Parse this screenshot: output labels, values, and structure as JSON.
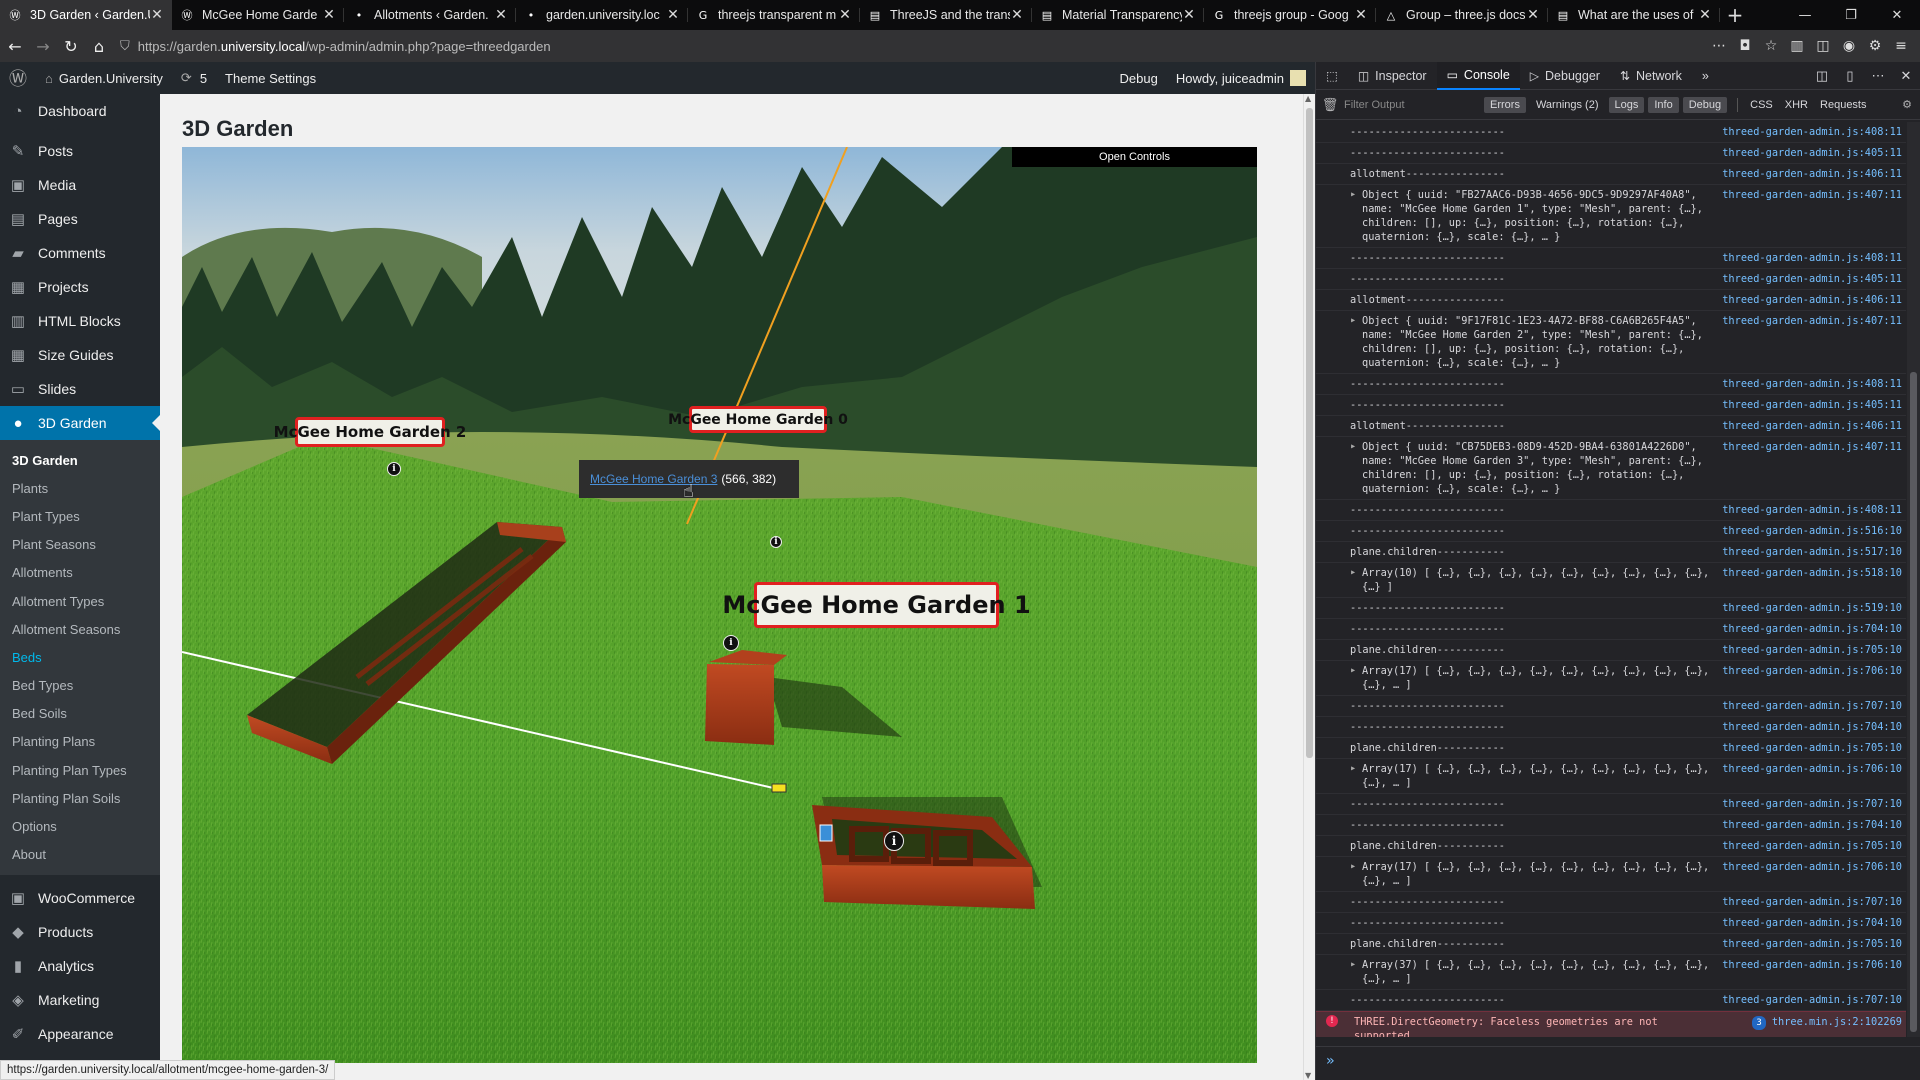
{
  "browser": {
    "tabs": [
      {
        "title": "3D Garden ‹ Garden.U",
        "icon": "wp-favicon",
        "active": true
      },
      {
        "title": "McGee Home Garde",
        "icon": "wp-favicon",
        "active": false
      },
      {
        "title": "Allotments ‹ Garden.",
        "icon": "dot-icon",
        "active": false
      },
      {
        "title": "garden.university.loc",
        "icon": "dot-icon",
        "active": false
      },
      {
        "title": "threejs transparent m",
        "icon": "google-icon",
        "active": false
      },
      {
        "title": "ThreeJS and the trans",
        "icon": "page-icon",
        "active": false
      },
      {
        "title": "Material Transparency",
        "icon": "page-icon",
        "active": false
      },
      {
        "title": "threejs group - Goog",
        "icon": "google-icon",
        "active": false
      },
      {
        "title": "Group – three.js docs",
        "icon": "three-icon",
        "active": false
      },
      {
        "title": "What are the uses of",
        "icon": "page-icon",
        "active": false
      }
    ],
    "url_prefix": "https://garden.",
    "url_host": "university.local",
    "url_path": "/wp-admin/admin.php?page=threedgarden",
    "status_url": "https://garden.university.local/allotment/mcgee-home-garden-3/"
  },
  "adminbar": {
    "site_name": "Garden.University",
    "updates_count": "5",
    "theme_settings": "Theme Settings",
    "debug": "Debug",
    "howdy": "Howdy, juiceadmin"
  },
  "sidebar": {
    "menu_top": [
      {
        "label": "Dashboard",
        "icon": "dashboard-icon"
      },
      {
        "label": "Posts",
        "icon": "pin-icon"
      },
      {
        "label": "Media",
        "icon": "media-icon"
      },
      {
        "label": "Pages",
        "icon": "pages-icon"
      },
      {
        "label": "Comments",
        "icon": "comment-icon"
      },
      {
        "label": "Projects",
        "icon": "projects-icon"
      },
      {
        "label": "HTML Blocks",
        "icon": "blocks-icon"
      },
      {
        "label": "Size Guides",
        "icon": "table-icon"
      },
      {
        "label": "Slides",
        "icon": "slides-icon"
      },
      {
        "label": "3D Garden",
        "icon": "garden-icon"
      }
    ],
    "submenu": [
      "3D Garden",
      "Plants",
      "Plant Types",
      "Plant Seasons",
      "Allotments",
      "Allotment Types",
      "Allotment Seasons",
      "Beds",
      "Bed Types",
      "Bed Soils",
      "Planting Plans",
      "Planting Plan Types",
      "Planting Plan Soils",
      "Options",
      "About"
    ],
    "menu_bottom": [
      {
        "label": "WooCommerce",
        "icon": "woo-icon"
      },
      {
        "label": "Products",
        "icon": "products-icon"
      },
      {
        "label": "Analytics",
        "icon": "analytics-icon"
      },
      {
        "label": "Marketing",
        "icon": "marketing-icon"
      },
      {
        "label": "Appearance",
        "icon": "appearance-icon"
      }
    ]
  },
  "page": {
    "title": "3D Garden",
    "open_controls": "Open Controls",
    "labels": {
      "garden0": "McGee Home Garden 0",
      "garden1": "McGee Home Garden 1",
      "garden2": "McGee Home Garden 2"
    },
    "tooltip": {
      "link": "McGee Home Garden 3",
      "coords": "(566, 382)"
    },
    "info_glyph": "i"
  },
  "devtools": {
    "tabs": [
      "Inspector",
      "Console",
      "Debugger",
      "Network"
    ],
    "filter_placeholder": "Filter Output",
    "filters": [
      "Errors",
      "Warnings (2)",
      "Logs",
      "Info",
      "Debug"
    ],
    "net_filters": [
      "CSS",
      "XHR",
      "Requests"
    ],
    "rows": [
      {
        "msg": "-------------------------",
        "src": "threed-garden-admin.js:408:11"
      },
      {
        "msg": "-------------------------",
        "src": "threed-garden-admin.js:405:11"
      },
      {
        "msg": "allotment----------------",
        "src": "threed-garden-admin.js:406:11"
      },
      {
        "obj": true,
        "msg": "Object { uuid: \"FB27AAC6-D93B-4656-9DC5-9D9297AF40A8\", name: \"McGee Home Garden 1\", type: \"Mesh\", parent: {…}, children: [], up: {…}, position: {…}, rotation: {…}, quaternion: {…}, scale: {…}, … }",
        "src": "threed-garden-admin.js:407:11"
      },
      {
        "msg": "-------------------------",
        "src": "threed-garden-admin.js:408:11"
      },
      {
        "msg": "-------------------------",
        "src": "threed-garden-admin.js:405:11"
      },
      {
        "msg": "allotment----------------",
        "src": "threed-garden-admin.js:406:11"
      },
      {
        "obj": true,
        "msg": "Object { uuid: \"9F17F81C-1E23-4A72-BF88-C6A6B265F4A5\", name: \"McGee Home Garden 2\", type: \"Mesh\", parent: {…}, children: [], up: {…}, position: {…}, rotation: {…}, quaternion: {…}, scale: {…}, … }",
        "src": "threed-garden-admin.js:407:11"
      },
      {
        "msg": "-------------------------",
        "src": "threed-garden-admin.js:408:11"
      },
      {
        "msg": "-------------------------",
        "src": "threed-garden-admin.js:405:11"
      },
      {
        "msg": "allotment----------------",
        "src": "threed-garden-admin.js:406:11"
      },
      {
        "obj": true,
        "msg": "Object { uuid: \"CB75DEB3-08D9-452D-9BA4-63801A4226D0\", name: \"McGee Home Garden 3\", type: \"Mesh\", parent: {…}, children: [], up: {…}, position: {…}, rotation: {…}, quaternion: {…}, scale: {…}, … }",
        "src": "threed-garden-admin.js:407:11"
      },
      {
        "msg": "-------------------------",
        "src": "threed-garden-admin.js:408:11"
      },
      {
        "msg": "-------------------------",
        "src": "threed-garden-admin.js:516:10"
      },
      {
        "msg": "plane.children-----------",
        "src": "threed-garden-admin.js:517:10"
      },
      {
        "obj": true,
        "msg": "Array(10) [ {…}, {…}, {…}, {…}, {…}, {…}, {…}, {…}, {…}, {…} ]",
        "src": "threed-garden-admin.js:518:10"
      },
      {
        "msg": "-------------------------",
        "src": "threed-garden-admin.js:519:10"
      },
      {
        "msg": "-------------------------",
        "src": "threed-garden-admin.js:704:10"
      },
      {
        "msg": "plane.children-----------",
        "src": "threed-garden-admin.js:705:10"
      },
      {
        "obj": true,
        "msg": "Array(17) [ {…}, {…}, {…}, {…}, {…}, {…}, {…}, {…}, {…}, {…}, … ]",
        "src": "threed-garden-admin.js:706:10"
      },
      {
        "msg": "-------------------------",
        "src": "threed-garden-admin.js:707:10"
      },
      {
        "msg": "-------------------------",
        "src": "threed-garden-admin.js:704:10"
      },
      {
        "msg": "plane.children-----------",
        "src": "threed-garden-admin.js:705:10"
      },
      {
        "obj": true,
        "msg": "Array(17) [ {…}, {…}, {…}, {…}, {…}, {…}, {…}, {…}, {…}, {…}, … ]",
        "src": "threed-garden-admin.js:706:10"
      },
      {
        "msg": "-------------------------",
        "src": "threed-garden-admin.js:707:10"
      },
      {
        "msg": "-------------------------",
        "src": "threed-garden-admin.js:704:10"
      },
      {
        "msg": "plane.children-----------",
        "src": "threed-garden-admin.js:705:10"
      },
      {
        "obj": true,
        "msg": "Array(17) [ {…}, {…}, {…}, {…}, {…}, {…}, {…}, {…}, {…}, {…}, … ]",
        "src": "threed-garden-admin.js:706:10"
      },
      {
        "msg": "-------------------------",
        "src": "threed-garden-admin.js:707:10"
      },
      {
        "msg": "-------------------------",
        "src": "threed-garden-admin.js:704:10"
      },
      {
        "msg": "plane.children-----------",
        "src": "threed-garden-admin.js:705:10"
      },
      {
        "obj": true,
        "msg": "Array(37) [ {…}, {…}, {…}, {…}, {…}, {…}, {…}, {…}, {…}, {…}, … ]",
        "src": "threed-garden-admin.js:706:10"
      },
      {
        "msg": "-------------------------",
        "src": "threed-garden-admin.js:707:10"
      }
    ],
    "error": {
      "msg": "THREE.DirectGeometry: Faceless geometries are not supported.",
      "count": "3",
      "src": "three.min.js:2:102269"
    },
    "prompt": "»"
  },
  "colors": {
    "wp_dark": "#23282d",
    "wp_accent": "#0073aa",
    "label_border": "#e02020",
    "console_link": "#75bfff"
  }
}
